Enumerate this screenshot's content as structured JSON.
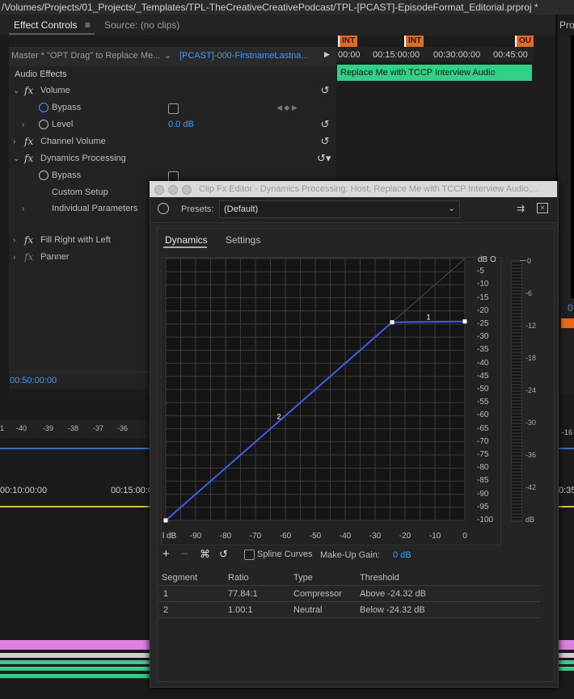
{
  "window": {
    "title": "/Volumes/Projects/01_Projects/_Templates/TPL-TheCreativeCreativePodcast/TPL-[PCAST]-EpisodeFormat_Editorial.prproj *"
  },
  "tabs": {
    "effect_controls": "Effect Controls",
    "source": "Source: (no clips)",
    "program": "Pro"
  },
  "effect_controls": {
    "master_label": "Master * \"OPT Drag\" to Replace Me...",
    "clip_label": "[PCAST]-000-FirstnameLastna...",
    "section_header": "Audio Effects",
    "rows": [
      {
        "name": "Volume"
      },
      {
        "name": "Bypass"
      },
      {
        "name": "Level",
        "value": "0.0 dB"
      },
      {
        "name": "Channel Volume"
      },
      {
        "name": "Dynamics Processing"
      },
      {
        "name": "Bypass"
      },
      {
        "name": "Custom Setup"
      },
      {
        "name": "Individual Parameters"
      },
      {
        "name": "Fill Right with Left"
      },
      {
        "name": "Panner"
      }
    ],
    "timecode": "00:50:00:00"
  },
  "timeline_mini": {
    "markers": [
      "INT",
      "INT",
      "OU"
    ],
    "ruler": [
      "00:00",
      "00:15:00:00",
      "00:30:00:00",
      "00:45:00"
    ],
    "clip_name": "Replace Me with TCCP Interview Audio"
  },
  "lower_timeline": {
    "meter_ticks": [
      "1",
      "-40",
      "-39",
      "-38",
      "-37",
      "-36",
      "-16"
    ],
    "time_ticks": [
      "00:10:00:00",
      "00:15:00:0",
      "0:35:"
    ]
  },
  "program_side": {
    "value": "0"
  },
  "dialog": {
    "title": "Clip Fx Editor - Dynamics Processing: Host, Replace Me with TCCP Interview Audio,...",
    "presets_label": "Presets:",
    "preset_value": "(Default)",
    "tabs": [
      "Dynamics",
      "Settings"
    ],
    "graph": {
      "y_title": "dB O",
      "y_ticks": [
        "-5",
        "-10",
        "-15",
        "-20",
        "-25",
        "-30",
        "-35",
        "-40",
        "-45",
        "-50",
        "-55",
        "-60",
        "-65",
        "-70",
        "-75",
        "-80",
        "-85",
        "-90",
        "-95",
        "-100"
      ],
      "x_title": "l dB",
      "x_ticks": [
        "-90",
        "-80",
        "-70",
        "-60",
        "-50",
        "-40",
        "-30",
        "-20",
        "-10",
        "0"
      ],
      "point_labels": [
        "1",
        "2"
      ]
    },
    "meter_ticks": [
      "0",
      "-6",
      "-12",
      "-18",
      "-24",
      "-30",
      "-36",
      "-42",
      "dB"
    ],
    "spline_label": "Spline Curves",
    "makeup_label": "Make-Up Gain:",
    "makeup_value": "0 dB",
    "table_headers": [
      "Segment",
      "Ratio",
      "Type",
      "Threshold"
    ],
    "table_rows": [
      [
        "1",
        "77.84:1",
        "Compressor",
        "Above -24.32 dB"
      ],
      [
        "2",
        "1.00:1",
        "Neutral",
        "Below -24.32 dB"
      ]
    ]
  },
  "chart_data": {
    "type": "line",
    "x": [
      -100,
      -24.32,
      0
    ],
    "y": [
      -100,
      -24.32,
      -24.0
    ],
    "xlim": [
      -100,
      0
    ],
    "ylim": [
      -100,
      0
    ],
    "grid": true,
    "series": [
      {
        "values": [
          -100,
          -24.32,
          -24.0
        ]
      }
    ]
  }
}
